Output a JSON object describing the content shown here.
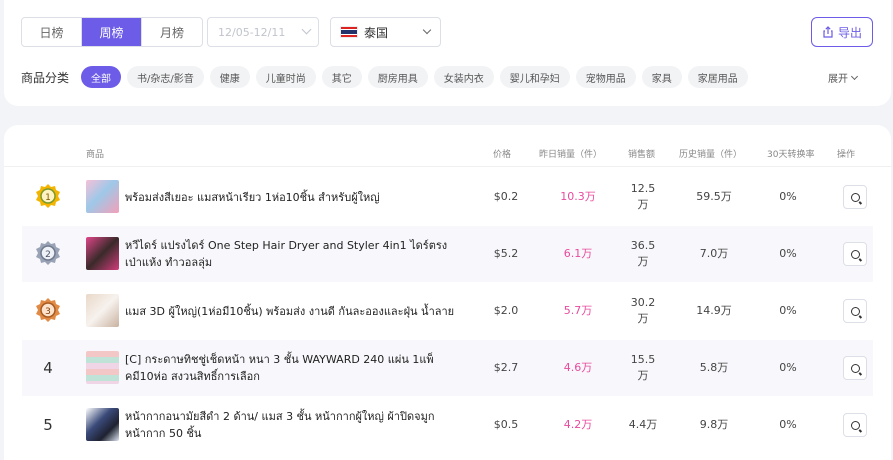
{
  "filters": {
    "period_tabs": [
      {
        "label": "日榜",
        "active": false
      },
      {
        "label": "周榜",
        "active": true
      },
      {
        "label": "月榜",
        "active": false
      }
    ],
    "date_range_placeholder": "12/05-12/11",
    "country": {
      "label": "泰国",
      "flag": "thailand-flag-icon"
    },
    "export_label": "导出"
  },
  "categories": {
    "label": "商品分类",
    "items": [
      {
        "label": "全部",
        "active": true
      },
      {
        "label": "书/杂志/影音",
        "active": false
      },
      {
        "label": "健康",
        "active": false
      },
      {
        "label": "儿童时尚",
        "active": false
      },
      {
        "label": "其它",
        "active": false
      },
      {
        "label": "厨房用具",
        "active": false
      },
      {
        "label": "女装内衣",
        "active": false
      },
      {
        "label": "婴儿和孕妇",
        "active": false
      },
      {
        "label": "宠物用品",
        "active": false
      },
      {
        "label": "家具",
        "active": false
      },
      {
        "label": "家居用品",
        "active": false
      }
    ],
    "expand_label": "展开"
  },
  "table": {
    "headers": {
      "product": "商品",
      "price": "价格",
      "yesterday_sales": "昨日销量（件）",
      "sales_amount": "销售额",
      "history_sales": "历史销量（件）",
      "conversion": "30天转换率",
      "action": "操作"
    },
    "rows": [
      {
        "rank": "1",
        "medal": "gold",
        "name": "พร้อมส่งสีเยอะ แมสหน้าเรียว 1ห่อ10ชิ้น สำหรับผู้ใหญ่",
        "price": "$0.2",
        "yesterday": "10.3万",
        "sales": "12.5 万",
        "history": "59.5万",
        "conversion": "0%"
      },
      {
        "rank": "2",
        "medal": "silver",
        "name": "หวีไดร์ แปรงไดร์ One Step Hair Dryer and Styler 4in1 ไดร์ตรง เป่าแห้ง ทำวอลลุ่ม",
        "price": "$5.2",
        "yesterday": "6.1万",
        "sales": "36.5 万",
        "history": "7.0万",
        "conversion": "0%"
      },
      {
        "rank": "3",
        "medal": "bronze",
        "name": "แมส 3D ผู้ใหญ่(1ห่อมี10ชิ้น) พร้อมส่ง งานดี กันละอองและฝุ่น น้ำลาย",
        "price": "$2.0",
        "yesterday": "5.7万",
        "sales": "30.2 万",
        "history": "14.9万",
        "conversion": "0%"
      },
      {
        "rank": "4",
        "medal": "",
        "name": "[C] กระดาษทิชชู่เช็ดหน้า หนา 3 ชั้น WAYWARD 240 แผ่น 1แพ็คมี10ห่อ สงวนสิทธิ์การเลือก",
        "price": "$2.7",
        "yesterday": "4.6万",
        "sales": "15.5 万",
        "history": "5.8万",
        "conversion": "0%"
      },
      {
        "rank": "5",
        "medal": "",
        "name": "หน้ากากอนามัยสีดำ 2 ด้าน/ แมส 3 ชั้น หน้ากากผู้ใหญ่ ผ้าปิดจมูก หน้ากาก 50 ชิ้น",
        "price": "$0.5",
        "yesterday": "4.2万",
        "sales": "4.4万",
        "history": "9.8万",
        "conversion": "0%"
      }
    ]
  },
  "colors": {
    "accent": "#6c5ce7",
    "pink": "#e84a9c",
    "gold": "#f5b400",
    "silver": "#9aa3b5",
    "bronze": "#e08a45"
  }
}
